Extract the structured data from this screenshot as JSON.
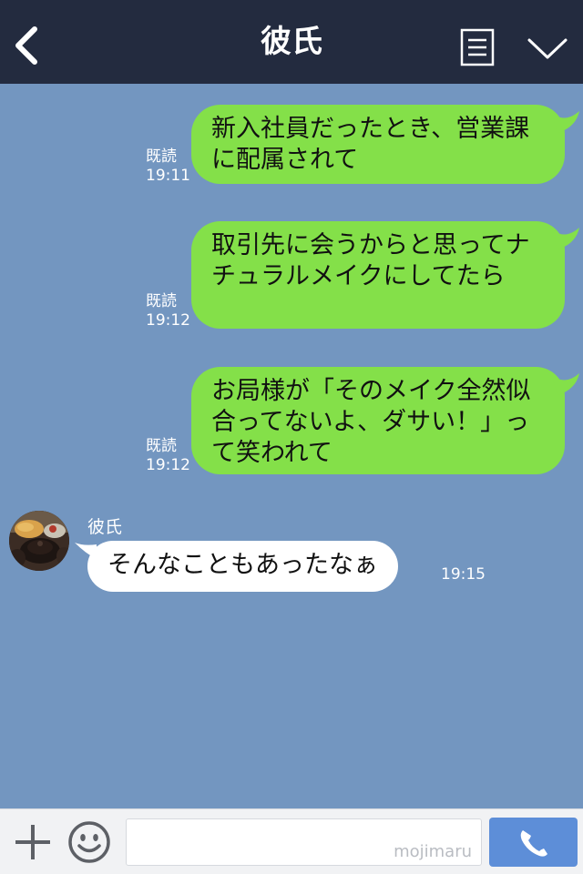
{
  "header": {
    "title": "彼氏",
    "back_icon": "chevron-left-icon",
    "menu_icon": "list-icon",
    "expand_icon": "chevron-down-icon",
    "background": "#232b3f"
  },
  "chat": {
    "background": "#7396c0",
    "outgoing": [
      {
        "read_label": "既読",
        "time": "19:11",
        "text": "新入社員だったとき、営業課に配属されて"
      },
      {
        "read_label": "既読",
        "time": "19:12",
        "text": "取引先に会うからと思ってナチュラルメイクにしてたら"
      },
      {
        "read_label": "既読",
        "time": "19:12",
        "text": "お局様が「そのメイク全然似合ってないよ、ダサい！」って笑われて"
      }
    ],
    "incoming": {
      "sender": "彼氏",
      "text": "そんなこともあったなぁ",
      "time": "19:15"
    },
    "outgoing_bubble_color": "#84e049",
    "incoming_bubble_color": "#ffffff"
  },
  "input_bar": {
    "plus_icon": "plus-icon",
    "emoji_icon": "smiley-icon",
    "watermark": "mojimaru",
    "call_icon": "phone-icon",
    "call_button_color": "#5d8ed8"
  }
}
